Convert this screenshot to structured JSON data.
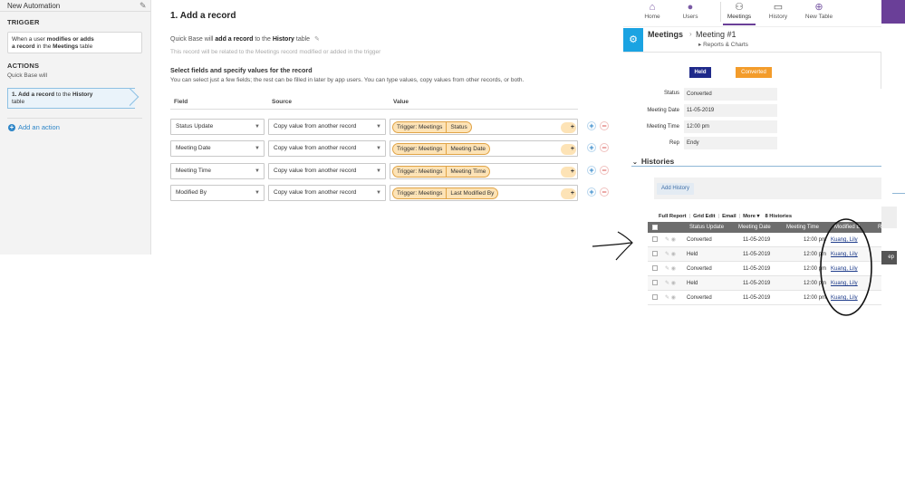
{
  "automation": {
    "title": "New Automation",
    "trigger_heading": "TRIGGER",
    "trigger_text_1": "When a user ",
    "trigger_bold_1": "modifies or adds",
    "trigger_bold_2": "a record",
    "trigger_text_2": " in the ",
    "trigger_bold_3": "Meetings",
    "trigger_text_3": " table",
    "actions_heading": "ACTIONS",
    "actions_sub": "Quick Base will",
    "action_prefix": "1. ",
    "action_bold_1": "Add a record",
    "action_text_1": " to the ",
    "action_bold_2": "History",
    "action_text_2": "table",
    "add_action": "Add an action"
  },
  "add_record": {
    "title": "1. Add a record",
    "desc_1": "Quick Base will ",
    "desc_bold_1": "add a record",
    "desc_2": " to the ",
    "desc_bold_2": "History",
    "desc_3": " table",
    "note": "This record will be related to the Meetings record modified or added in the trigger",
    "fields_heading": "Select fields and specify values for the record",
    "fields_sub": "You can select just a few fields; the rest can be filled in later by app users. You can type values, copy values from other records, or both.",
    "columns": {
      "field": "Field",
      "source": "Source",
      "value": "Value"
    },
    "rows": [
      {
        "field": "Status Update",
        "source": "Copy value from another record",
        "pill_source": "Trigger: Meetings",
        "pill_field": "Status"
      },
      {
        "field": "Meeting Date",
        "source": "Copy value from another record",
        "pill_source": "Trigger: Meetings",
        "pill_field": "Meeting Date"
      },
      {
        "field": "Meeting Time",
        "source": "Copy value from another record",
        "pill_source": "Trigger: Meetings",
        "pill_field": "Meeting Time"
      },
      {
        "field": "Modified By",
        "source": "Copy value from another record",
        "pill_source": "Trigger: Meetings",
        "pill_field": "Last Modified By"
      }
    ]
  },
  "quickbase": {
    "nav": [
      {
        "label": "Home",
        "icon": "home-icon"
      },
      {
        "label": "Users",
        "icon": "user-icon"
      },
      {
        "label": "Meetings",
        "icon": "people-icon"
      },
      {
        "label": "History",
        "icon": "folder-icon"
      },
      {
        "label": "New Table",
        "icon": "plus-circle-icon"
      }
    ],
    "crumb_table": "Meetings",
    "crumb_record": "Meeting #1",
    "crumb_sub": "Reports & Charts",
    "badge_held": "Held",
    "badge_converted": "Converted",
    "fields": [
      {
        "label": "Status",
        "value": "Converted"
      },
      {
        "label": "Meeting Date",
        "value": "11-05-2019"
      },
      {
        "label": "Meeting Time",
        "value": "12:00 pm"
      },
      {
        "label": "Rep",
        "value": "Endy"
      }
    ],
    "histories_heading": "Histories",
    "add_history": "Add History",
    "side_label": "ep",
    "report_toolbar": {
      "full_report": "Full Report",
      "grid_edit": "Grid Edit",
      "email": "Email",
      "more": "More ▾",
      "count": "8 Histories"
    },
    "report_columns": [
      "Status Update",
      "Meeting Date",
      "Meeting Time",
      "Modified B",
      "R"
    ],
    "report_rows": [
      {
        "status": "Converted",
        "date": "11-05-2019",
        "time": "12:00 pm",
        "modified_by": "Kuang, Lily"
      },
      {
        "status": "Held",
        "date": "11-05-2019",
        "time": "12:00 pm",
        "modified_by": "Kuang, Lily"
      },
      {
        "status": "Converted",
        "date": "11-05-2019",
        "time": "12:00 pm",
        "modified_by": "Kuang, Lily"
      },
      {
        "status": "Held",
        "date": "11-05-2019",
        "time": "12:00 pm",
        "modified_by": "Kuang, Lily"
      },
      {
        "status": "Converted",
        "date": "11-05-2019",
        "time": "12:00 pm",
        "modified_by": "Kuang, Lily"
      }
    ]
  },
  "colors": {
    "quickbase_purple": "#6a3f98",
    "link_blue": "#2e86c8",
    "pill_orange": "#fde3b6",
    "held_badge": "#1f2a8a",
    "converted_badge": "#f39c2b"
  }
}
